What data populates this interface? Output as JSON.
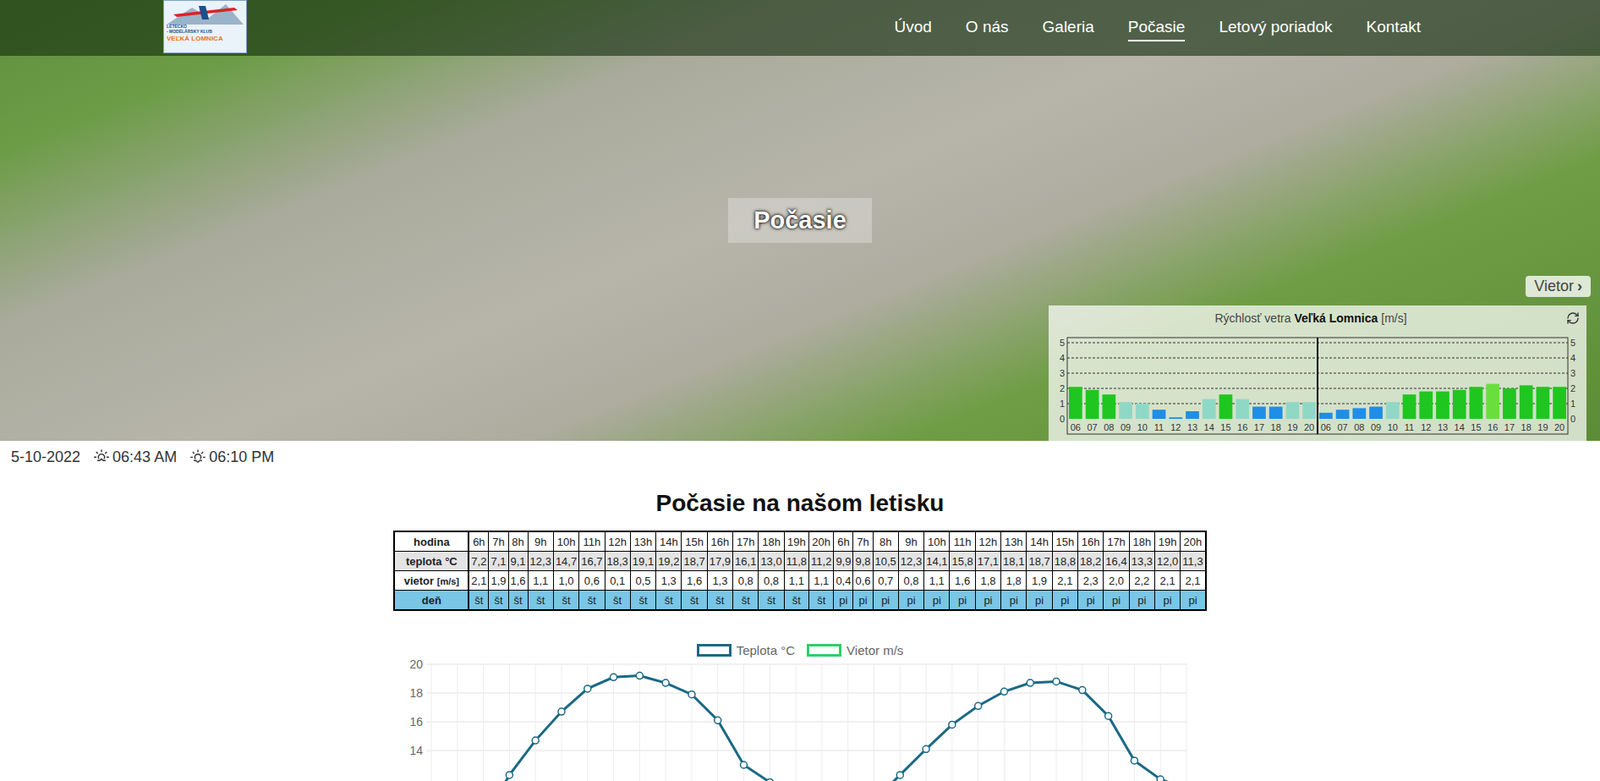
{
  "nav": {
    "logo": {
      "lines": [
        "LETECKO",
        "- MODELÁRSKY KLUB",
        "VEĽKÁ LOMNICA"
      ]
    },
    "items": [
      {
        "label": "Úvod",
        "selected": false
      },
      {
        "label": "O nás",
        "selected": false
      },
      {
        "label": "Galeria",
        "selected": false
      },
      {
        "label": "Počasie",
        "selected": true
      },
      {
        "label": "Letový poriadok",
        "selected": false
      },
      {
        "label": "Kontakt",
        "selected": false
      }
    ]
  },
  "hero": {
    "title": "Počasie"
  },
  "windWidget": {
    "button": "Vietor",
    "buttonIcon": "›",
    "title": {
      "prefix": "Rýchlosť vetra",
      "place": "Veľká Lomnica",
      "unit": "[m/s]"
    },
    "yTicks": [
      "0",
      "1",
      "2",
      "3",
      "4",
      "5"
    ],
    "days": [
      {
        "hours": [
          "06",
          "07",
          "08",
          "09",
          "10",
          "11",
          "12",
          "13",
          "14",
          "15",
          "16",
          "17",
          "18",
          "19",
          "20"
        ],
        "values": [
          2.1,
          1.9,
          1.6,
          1.1,
          1.0,
          0.6,
          0.1,
          0.5,
          1.3,
          1.6,
          1.3,
          0.8,
          0.8,
          1.1,
          1.1
        ]
      },
      {
        "hours": [
          "06",
          "07",
          "08",
          "09",
          "10",
          "11",
          "12",
          "13",
          "14",
          "15",
          "16",
          "17",
          "18",
          "19",
          "20"
        ],
        "values": [
          0.4,
          0.6,
          0.7,
          0.8,
          1.1,
          1.6,
          1.8,
          1.8,
          1.9,
          2.1,
          2.3,
          2.0,
          2.2,
          2.1,
          2.1
        ]
      }
    ]
  },
  "info": {
    "date": "5-10-2022",
    "sunrise": "06:43 AM",
    "sunset": "06:10 PM"
  },
  "table": {
    "title": "Počasie na našom letisku",
    "rows": [
      {
        "kind": "hour",
        "header": "hodina",
        "unit": "",
        "cells": [
          "6h",
          "7h",
          "8h",
          "9h",
          "10h",
          "11h",
          "12h",
          "13h",
          "14h",
          "15h",
          "16h",
          "17h",
          "18h",
          "19h",
          "20h",
          "6h",
          "7h",
          "8h",
          "9h",
          "10h",
          "11h",
          "12h",
          "13h",
          "14h",
          "15h",
          "16h",
          "17h",
          "18h",
          "19h",
          "20h"
        ]
      },
      {
        "kind": "temp",
        "header": "teplota °C",
        "unit": "",
        "cells": [
          "7,2",
          "7,1",
          "9,1",
          "12,3",
          "14,7",
          "16,7",
          "18,3",
          "19,1",
          "19,2",
          "18,7",
          "17,9",
          "16,1",
          "13,0",
          "11,8",
          "11,2",
          "9,9",
          "9,8",
          "10,5",
          "12,3",
          "14,1",
          "15,8",
          "17,1",
          "18,1",
          "18,7",
          "18,8",
          "18,2",
          "16,4",
          "13,3",
          "12,0",
          "11,3"
        ]
      },
      {
        "kind": "wind",
        "header": "vietor",
        "unit": "[m/s]",
        "cells": [
          "2,1",
          "1,9",
          "1,6",
          "1,1",
          "1,0",
          "0,6",
          "0,1",
          "0,5",
          "1,3",
          "1,6",
          "1,3",
          "0,8",
          "0,8",
          "1,1",
          "1,1",
          "0,4",
          "0,6",
          "0,7",
          "0,8",
          "1,1",
          "1,6",
          "1,8",
          "1,8",
          "1,9",
          "2,1",
          "2,3",
          "2,0",
          "2,2",
          "2,1",
          "2,1"
        ]
      },
      {
        "kind": "day",
        "header": "deň",
        "unit": "",
        "cells": [
          "št",
          "št",
          "št",
          "št",
          "št",
          "št",
          "št",
          "št",
          "št",
          "št",
          "št",
          "št",
          "št",
          "št",
          "št",
          "pi",
          "pi",
          "pi",
          "pi",
          "pi",
          "pi",
          "pi",
          "pi",
          "pi",
          "pi",
          "pi",
          "pi",
          "pi",
          "pi",
          "pi"
        ]
      }
    ]
  },
  "chart": {
    "legend": [
      {
        "label": "Teplota °C",
        "color": "#1a6985"
      },
      {
        "label": "Vietor m/s",
        "color": "#33cc66"
      }
    ],
    "yTicks": [
      "20",
      "18",
      "16",
      "14"
    ],
    "series": [
      {
        "name": "Teplota °C",
        "color": "#1a6985",
        "values": [
          7.2,
          7.1,
          9.1,
          12.3,
          14.7,
          16.7,
          18.3,
          19.1,
          19.2,
          18.7,
          17.9,
          16.1,
          13.0,
          11.8,
          11.2,
          9.9,
          9.8,
          10.5,
          12.3,
          14.1,
          15.8,
          17.1,
          18.1,
          18.7,
          18.8,
          18.2,
          16.4,
          13.3,
          12.0,
          11.3
        ]
      },
      {
        "name": "Vietor m/s",
        "color": "#33cc66",
        "values": [
          2.1,
          1.9,
          1.6,
          1.1,
          1.0,
          0.6,
          0.1,
          0.5,
          1.3,
          1.6,
          1.3,
          0.8,
          0.8,
          1.1,
          1.1,
          0.4,
          0.6,
          0.7,
          0.8,
          1.1,
          1.6,
          1.8,
          1.8,
          1.9,
          2.1,
          2.3,
          2.0,
          2.2,
          2.1,
          2.1
        ]
      }
    ]
  }
}
